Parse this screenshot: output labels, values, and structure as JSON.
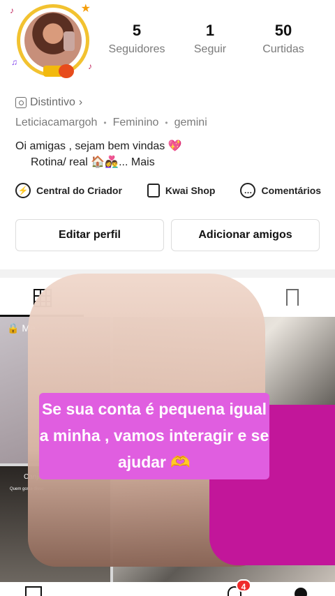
{
  "profile": {
    "stats": [
      {
        "value": "5",
        "label": "Seguidores"
      },
      {
        "value": "1",
        "label": "Seguir"
      },
      {
        "value": "50",
        "label": "Curtidas"
      }
    ],
    "badge_label": "Distintivo",
    "badge_chevron": "›",
    "username": "Leticiacamargoh",
    "gender": "Feminino",
    "sign": "gemini",
    "meta_separator": "•",
    "bio_line1": "Oi amigas , sejam bem vindas 💖",
    "bio_line2": "Rotina/ real 🏠👩‍❤️‍👨...",
    "bio_more": "Mais"
  },
  "tools": [
    {
      "label": "Central do Criador",
      "icon": "lightning-pin-icon"
    },
    {
      "label": "Kwai Shop",
      "icon": "shopping-bag-icon"
    },
    {
      "label": "Comentários",
      "icon": "comment-bubble-icon"
    }
  ],
  "buttons": {
    "edit_profile": "Editar perfil",
    "add_friends": "Adicionar amigos"
  },
  "tabs": {
    "grid_icon": "grid-icon",
    "saved_icon": "bookmark-icon"
  },
  "grid": {
    "cell1_label": "🔒 Me",
    "cell2_title": "Canjica",
    "cell2_sub": "Quem gosta disso"
  },
  "overlay": {
    "text": "Se sua conta é pequena igual a minha , vamos interagir e se ajudar 🫶"
  },
  "bottom_nav": {
    "home_icon": "home-icon",
    "inbox_icon": "chat-icon",
    "inbox_badge": "4",
    "me_icon": "profile-icon"
  },
  "colors": {
    "overlay_bg": "#e05ee0",
    "badge_red": "#ef2b2b",
    "avatar_ring": "#f2c230"
  }
}
